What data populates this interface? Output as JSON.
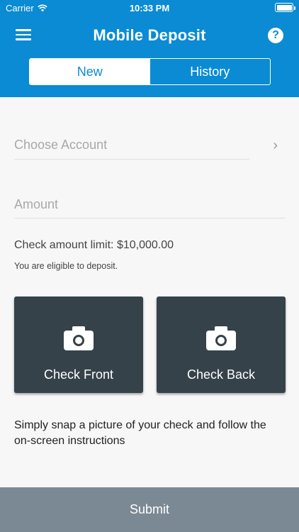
{
  "status_bar": {
    "carrier": "Carrier",
    "time": "10:33 PM"
  },
  "header": {
    "title": "Mobile Deposit",
    "menu_icon": "hamburger-menu-icon",
    "help_icon": "question-circle-icon",
    "help_glyph": "?"
  },
  "tabs": [
    {
      "label": "New",
      "active": true
    },
    {
      "label": "History",
      "active": false
    }
  ],
  "form": {
    "account_placeholder": "Choose Account",
    "chevron": "›",
    "amount_placeholder": "Amount",
    "limit_text": "Check amount limit: $10,000.00",
    "eligibility_text": "You are eligible to deposit."
  },
  "capture": {
    "front_label": "Check Front",
    "back_label": "Check Back",
    "icon": "camera-icon"
  },
  "instructions": "Simply snap a picture of your check and follow the on-screen instructions",
  "submit_label": "Submit",
  "colors": {
    "primary": "#0a8bd3",
    "card": "#35424a",
    "submit": "#7b8994",
    "background": "#f7f7f7"
  }
}
